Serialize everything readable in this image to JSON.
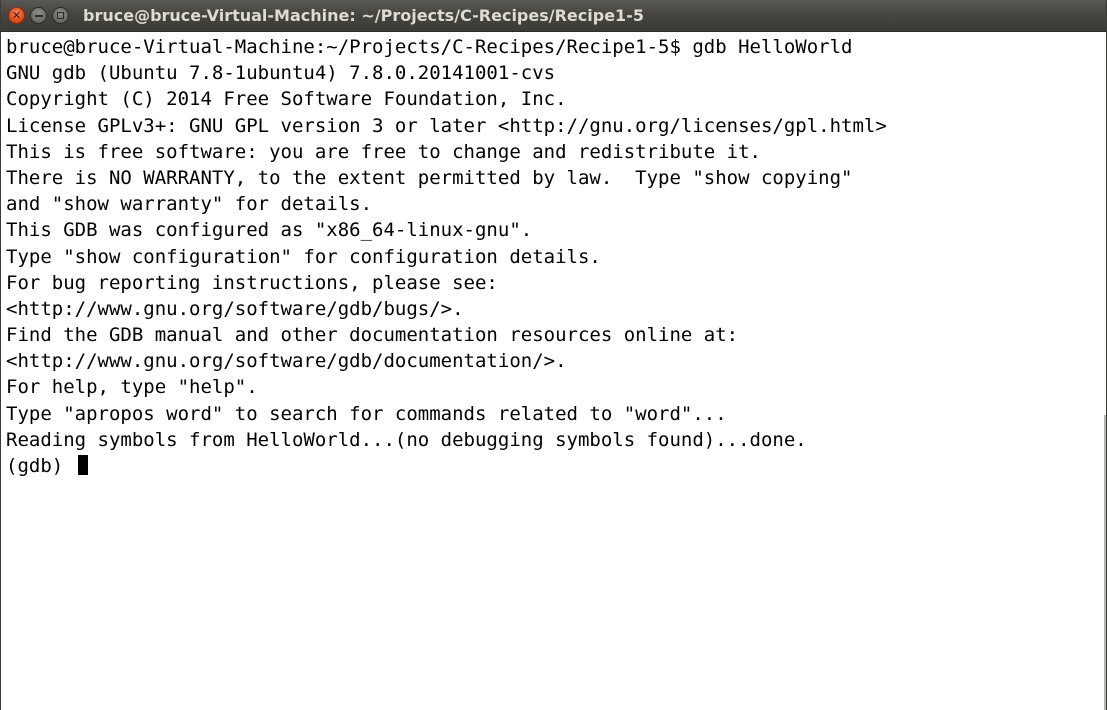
{
  "window": {
    "title": "bruce@bruce-Virtual-Machine: ~/Projects/C-Recipes/Recipe1-5",
    "controls": [
      "close-icon",
      "minimize-icon",
      "maximize-icon"
    ]
  },
  "terminal": {
    "lines": [
      "bruce@bruce-Virtual-Machine:~/Projects/C-Recipes/Recipe1-5$ gdb HelloWorld",
      "GNU gdb (Ubuntu 7.8-1ubuntu4) 7.8.0.20141001-cvs",
      "Copyright (C) 2014 Free Software Foundation, Inc.",
      "License GPLv3+: GNU GPL version 3 or later <http://gnu.org/licenses/gpl.html>",
      "This is free software: you are free to change and redistribute it.",
      "There is NO WARRANTY, to the extent permitted by law.  Type \"show copying\"",
      "and \"show warranty\" for details.",
      "This GDB was configured as \"x86_64-linux-gnu\".",
      "Type \"show configuration\" for configuration details.",
      "For bug reporting instructions, please see:",
      "<http://www.gnu.org/software/gdb/bugs/>.",
      "Find the GDB manual and other documentation resources online at:",
      "<http://www.gnu.org/software/gdb/documentation/>.",
      "For help, type \"help\".",
      "Type \"apropos word\" to search for commands related to \"word\"...",
      "Reading symbols from HelloWorld...(no debugging symbols found)...done."
    ],
    "prompt": "(gdb)"
  },
  "colors": {
    "titlebar": "#3c3b37",
    "title_text": "#dfdbd2",
    "close_button": "#e5501f",
    "terminal_bg": "#ffffff",
    "terminal_fg": "#000000"
  }
}
